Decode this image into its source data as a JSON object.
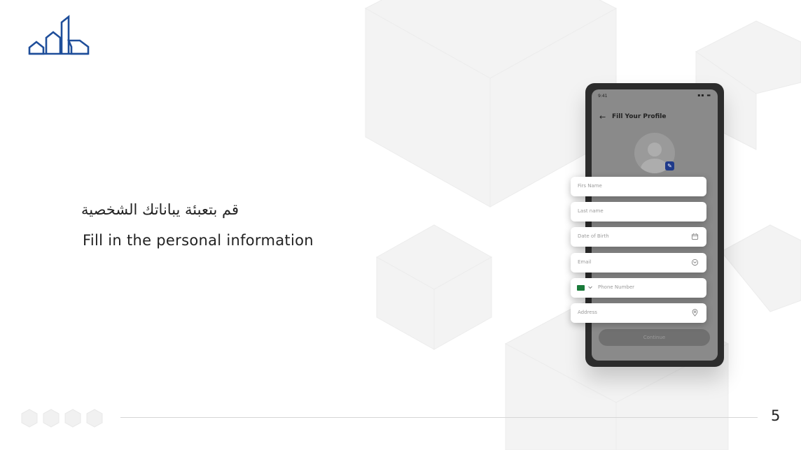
{
  "slide": {
    "title_ar": "قم بتعبئة يباناتك الشخصية",
    "title_en": "Fill in the personal information",
    "page_number": "5"
  },
  "phone": {
    "status_time": "9:41",
    "screen_title": "Fill Your Profile",
    "fields": [
      {
        "placeholder": "Firs Name",
        "icon": ""
      },
      {
        "placeholder": "Last name",
        "icon": ""
      },
      {
        "placeholder": "Date of Birth",
        "icon": "calendar-icon"
      },
      {
        "placeholder": "Email",
        "icon": "mail-icon"
      },
      {
        "placeholder": "Phone Number",
        "icon": "flag-icon"
      },
      {
        "placeholder": "Address",
        "icon": "location-pin-icon"
      }
    ],
    "continue_label": "Continue"
  },
  "colors": {
    "brand": "#1f4e9a",
    "accent": "#1f3a8a"
  }
}
